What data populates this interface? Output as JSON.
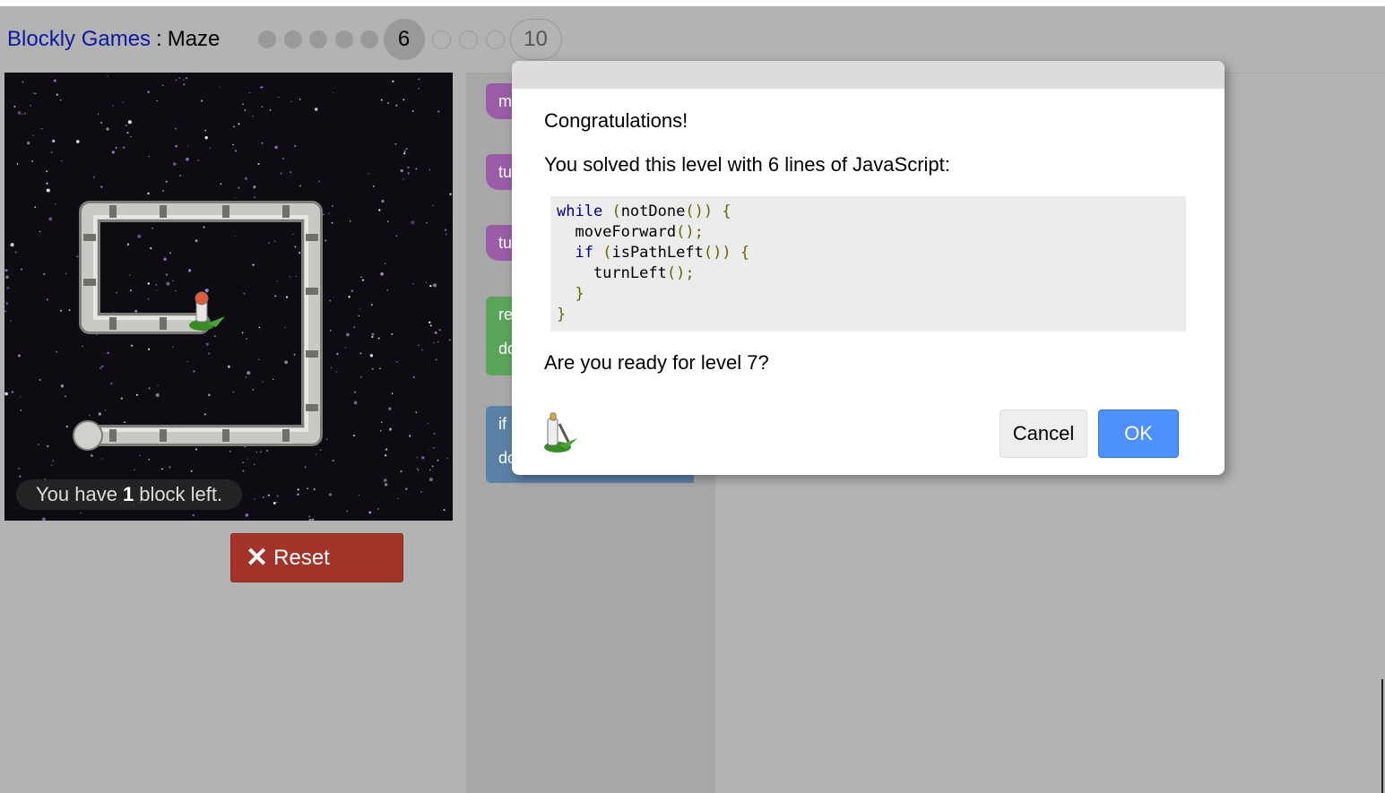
{
  "header": {
    "app_link": "Blockly Games",
    "separator": ":",
    "game": "Maze"
  },
  "levels": {
    "current": "6",
    "last": "10"
  },
  "maze": {
    "status_prefix": "You have",
    "blocks_left": "1",
    "status_suffix": "block left."
  },
  "reset_button": {
    "icon": "close-icon",
    "label": "Reset"
  },
  "toolbox": {
    "blocks": [
      "m",
      "tu",
      "tu",
      "re",
      "do",
      "if",
      "do"
    ]
  },
  "dialog": {
    "congrats": "Congratulations!",
    "solved": "You solved this level with 6 lines of JavaScript:",
    "code_lines": [
      "while (notDone()) {",
      "  moveForward();",
      "  if (isPathLeft()) {",
      "    turnLeft();",
      "  }",
      "}"
    ],
    "ready": "Are you ready for level 7?",
    "cancel_label": "Cancel",
    "ok_label": "OK"
  },
  "colors": {
    "link": "#0b1aa0",
    "reset": "#a4342a",
    "ok": "#4d90fe",
    "move_block": "#9a5ca6",
    "loop_block": "#5ba55b",
    "if_block": "#5b80a5"
  }
}
